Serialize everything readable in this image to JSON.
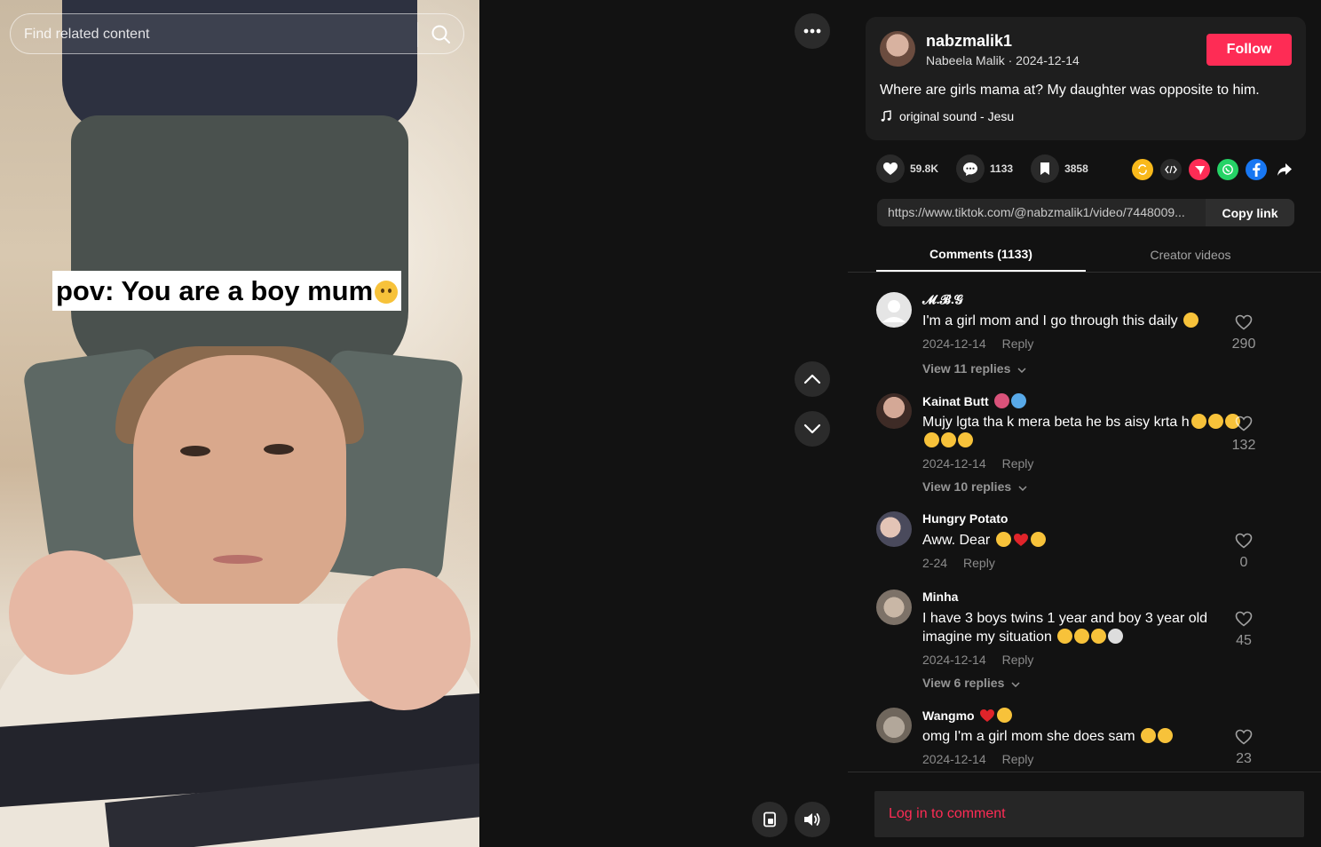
{
  "search": {
    "placeholder": "Find related content"
  },
  "video": {
    "caption_text": "pov: You are a boy mum"
  },
  "author": {
    "username": "nabzmalik1",
    "meta": "Nabeela Malik · 2024-12-14",
    "follow_label": "Follow",
    "description": "Where are girls mama at? My daughter was opposite to him.",
    "sound": "original sound - Jesu"
  },
  "actions": {
    "likes": "59.8K",
    "comments": "1133",
    "saves": "3858"
  },
  "share": {
    "icons": [
      "repost-icon",
      "embed-icon",
      "send-icon",
      "whatsapp-icon",
      "facebook-icon",
      "share-arrow-icon"
    ],
    "colors": {
      "repost": "#f9b91b",
      "send": "#fe2c55",
      "whatsapp": "#25d366",
      "facebook": "#1877f2"
    }
  },
  "link": {
    "url": "https://www.tiktok.com/@nabzmalik1/video/7448009...",
    "copy_label": "Copy link"
  },
  "tabs": {
    "comments": "Comments (1133)",
    "creator": "Creator videos"
  },
  "comments": [
    {
      "name": "𝓜.𝓑.𝓖",
      "text": "I'm a girl mom and I go through this daily",
      "date": "2024-12-14",
      "reply": "Reply",
      "replies": "View 11 replies",
      "likes": "290"
    },
    {
      "name": "Kainat Butt",
      "text": "Mujy lgta tha k mera beta he bs aisy krta h",
      "date": "2024-12-14",
      "reply": "Reply",
      "replies": "View 10 replies",
      "likes": "132"
    },
    {
      "name": "Hungry Potato",
      "text": "Aww. Dear",
      "date": "2-24",
      "reply": "Reply",
      "likes": "0"
    },
    {
      "name": "Minha",
      "text": "I have 3 boys twins 1 year and boy 3 year old imagine my situation",
      "date": "2024-12-14",
      "reply": "Reply",
      "replies": "View 6 replies",
      "likes": "45"
    },
    {
      "name": "Wangmo",
      "text": "omg I'm a girl mom she does sam",
      "date": "2024-12-14",
      "reply": "Reply",
      "likes": "23"
    }
  ],
  "login_comment": "Log in to comment",
  "colors": {
    "accent": "#fe2c55",
    "background": "#121212",
    "card": "#1e1e1e"
  }
}
